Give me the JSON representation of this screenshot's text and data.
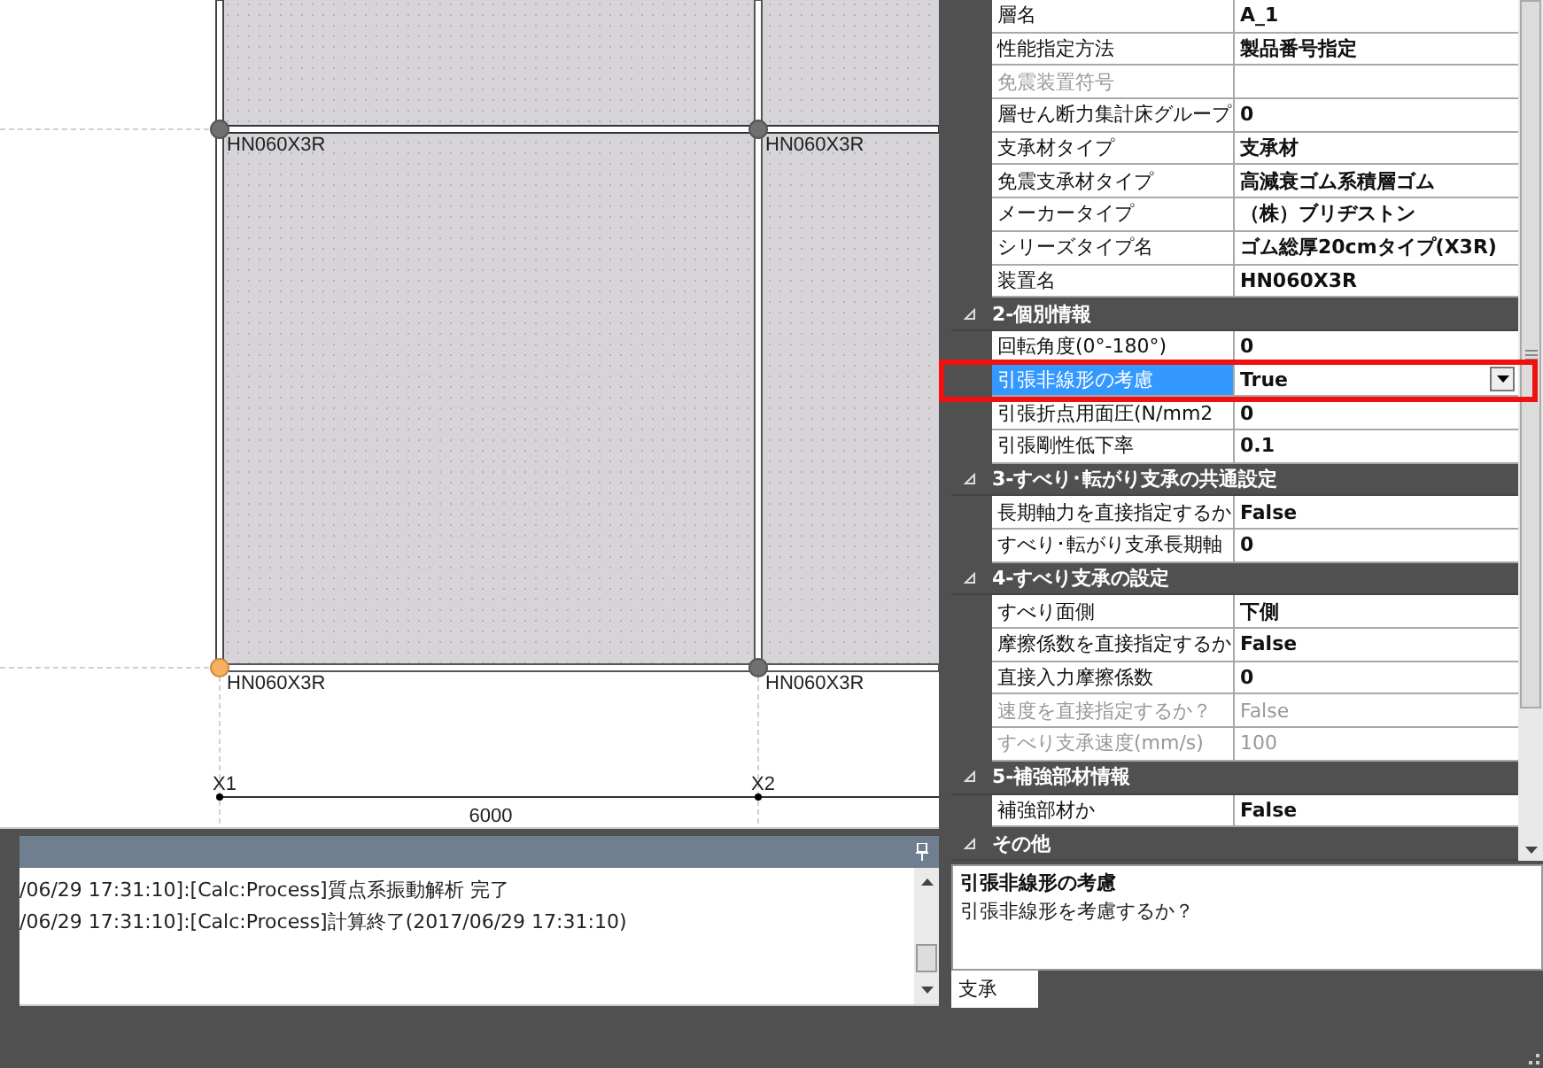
{
  "plan": {
    "device_labels": [
      "HN060X3R",
      "HN060X3R",
      "HN060X3R",
      "HN060X3R"
    ],
    "nodes": [
      {
        "selected": false
      },
      {
        "selected": false
      },
      {
        "selected": true
      },
      {
        "selected": false
      }
    ],
    "axes": [
      "X1",
      "X2"
    ],
    "dimension": "6000"
  },
  "log": {
    "lines": [
      "/06/29 17:31:10]:[Calc:Process]質点系振動解析 完了",
      "/06/29 17:31:10]:[Calc:Process]計算終了(2017/06/29 17:31:10)"
    ]
  },
  "properties": [
    {
      "kind": "row",
      "label": "層名",
      "value": "A_1",
      "disabled": false,
      "selected": false,
      "highlighted": false
    },
    {
      "kind": "row",
      "label": "性能指定方法",
      "value": "製品番号指定",
      "disabled": false,
      "selected": false,
      "highlighted": false
    },
    {
      "kind": "row",
      "label": "免震装置符号",
      "disabled": true,
      "selected": false,
      "highlighted": false
    },
    {
      "kind": "row",
      "label": "層せん断力集計床グループ",
      "value": "0",
      "disabled": false,
      "selected": false,
      "highlighted": false
    },
    {
      "kind": "row",
      "label": "支承材タイプ",
      "value": "支承材",
      "disabled": false,
      "selected": false,
      "highlighted": false
    },
    {
      "kind": "row",
      "label": "免震支承材タイプ",
      "value": "高減衰ゴム系積層ゴム",
      "disabled": false,
      "selected": false,
      "highlighted": false
    },
    {
      "kind": "row",
      "label": "メーカータイプ",
      "value": "（株）ブリヂストン",
      "disabled": false,
      "selected": false,
      "highlighted": false
    },
    {
      "kind": "row",
      "label": "シリーズタイプ名",
      "value": "ゴム総厚20cmタイプ(X3R)",
      "disabled": false,
      "selected": false,
      "highlighted": false
    },
    {
      "kind": "row",
      "label": "装置名",
      "value": "HN060X3R",
      "disabled": false,
      "selected": false,
      "highlighted": false
    },
    {
      "kind": "category",
      "label": "2-個別情報",
      "expanded": true
    },
    {
      "kind": "row",
      "label": "回転角度(0°-180°)",
      "value": "0",
      "disabled": false,
      "selected": false,
      "highlighted": false
    },
    {
      "kind": "row",
      "label": "引張非線形の考慮",
      "value": "True",
      "disabled": false,
      "selected": true,
      "highlighted": true
    },
    {
      "kind": "row",
      "label": "引張折点用面圧(N/mm2",
      "value": "0",
      "disabled": false,
      "selected": false,
      "highlighted": false
    },
    {
      "kind": "row",
      "label": "引張剛性低下率",
      "value": "0.1",
      "disabled": false,
      "selected": false,
      "highlighted": false
    },
    {
      "kind": "category",
      "label": "3-すべり･転がり支承の共通設定",
      "expanded": true
    },
    {
      "kind": "row",
      "label": "長期軸力を直接指定するか",
      "value": "False",
      "disabled": false,
      "selected": false,
      "highlighted": false
    },
    {
      "kind": "row",
      "label": "すべり･転がり支承長期軸",
      "value": "0",
      "disabled": false,
      "selected": false,
      "highlighted": false
    },
    {
      "kind": "category",
      "label": "4-すべり支承の設定",
      "expanded": true
    },
    {
      "kind": "row",
      "label": "すべり面側",
      "value": "下側",
      "disabled": false,
      "selected": false,
      "highlighted": false
    },
    {
      "kind": "row",
      "label": "摩擦係数を直接指定するか",
      "value": "False",
      "disabled": false,
      "selected": false,
      "highlighted": false
    },
    {
      "kind": "row",
      "label": "直接入力摩擦係数",
      "value": "0",
      "disabled": false,
      "selected": false,
      "highlighted": false
    },
    {
      "kind": "row",
      "label": "速度を直接指定するか？",
      "value": "False",
      "disabled": true,
      "selected": false,
      "highlighted": false
    },
    {
      "kind": "row",
      "label": "すべり支承速度(mm/s)",
      "value": "100",
      "disabled": true,
      "selected": false,
      "highlighted": false
    },
    {
      "kind": "category",
      "label": "5-補強部材情報",
      "expanded": true
    },
    {
      "kind": "row",
      "label": "補強部材か",
      "value": "False",
      "disabled": false,
      "selected": false,
      "highlighted": false
    },
    {
      "kind": "category",
      "label": "その他",
      "expanded": true
    }
  ],
  "description": {
    "title": "引張非線形の考慮",
    "text": "引張非線形を考慮するか？"
  },
  "tabs": [
    {
      "label": "支承",
      "selected": true
    }
  ]
}
